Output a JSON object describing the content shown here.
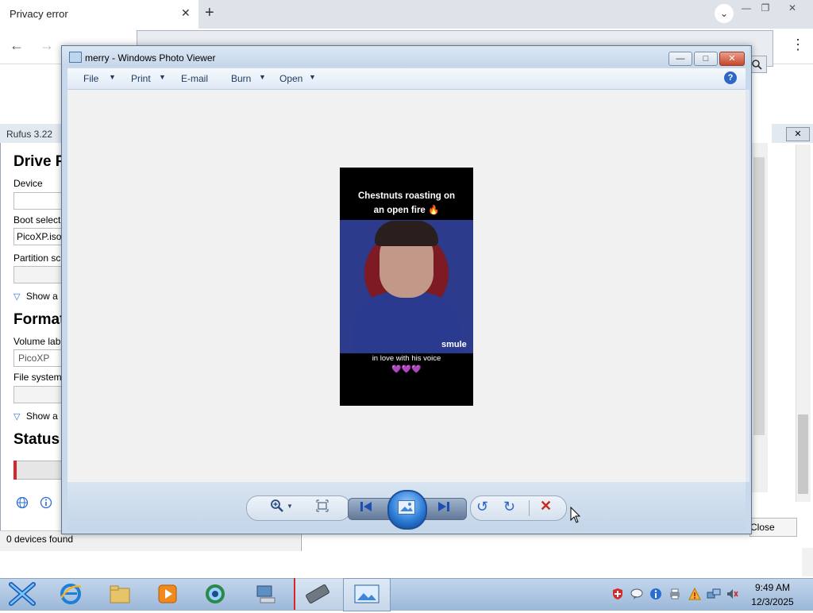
{
  "chrome": {
    "tab_title": "Privacy error",
    "tab_close": "✕",
    "new_tab": "+",
    "tab_list": "⌄",
    "minimize": "—",
    "restore": "❐",
    "close": "✕",
    "back": "←",
    "forward": "→",
    "menu": "⋮"
  },
  "rufus": {
    "title": "Rufus 3.22",
    "drive_heading": "Drive P",
    "device_label": "Device",
    "boot_selection_label": "Boot selecti",
    "boot_selection_value": "PicoXP.iso",
    "partition_scheme_label": "Partition sc",
    "show_advanced_drive": "Show a",
    "format_heading": "Format",
    "volume_label_label": "Volume lab",
    "volume_label_value": "PicoXP",
    "file_system_label": "File system",
    "show_advanced_format": "Show a",
    "status_heading": "Status",
    "status_bar_text": "0 devices found",
    "close_button": "Close",
    "close_x": "✕"
  },
  "photo_viewer": {
    "title": "merry - Windows Photo Viewer",
    "minimize": "—",
    "maximize": "□",
    "close": "✕",
    "menu": {
      "file": "File",
      "print": "Print",
      "email": "E-mail",
      "burn": "Burn",
      "open": "Open"
    },
    "help": "?",
    "photo": {
      "caption_top_line1": "Chestnuts roasting on",
      "caption_top_line2": "an open fire 🔥",
      "logo": "smule",
      "caption_bottom": "in love with his voice",
      "hearts": "💜💜💜"
    }
  },
  "taskbar": {
    "clock_time": "9:49 AM",
    "clock_date": "12/3/2025"
  },
  "icons": {
    "zoom": "🔍︎",
    "fit": "⛶",
    "prev": "⏮",
    "next": "⏭",
    "rotate_left": "↺",
    "rotate_right": "↻",
    "delete": "✕"
  }
}
